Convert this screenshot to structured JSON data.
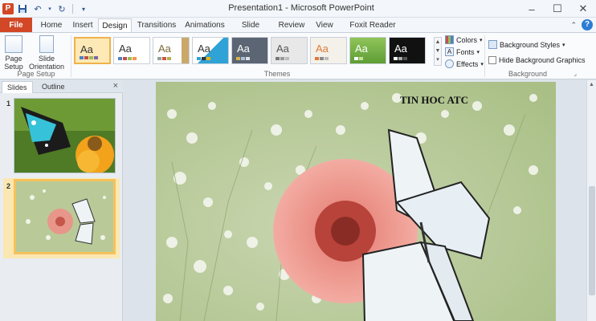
{
  "window": {
    "title": "Presentation1 - Microsoft PowerPoint"
  },
  "app_icon": "P",
  "tabs": [
    {
      "label": "File"
    },
    {
      "label": "Home"
    },
    {
      "label": "Insert"
    },
    {
      "label": "Design"
    },
    {
      "label": "Transitions"
    },
    {
      "label": "Animations"
    },
    {
      "label": "Slide Show"
    },
    {
      "label": "Review"
    },
    {
      "label": "View"
    },
    {
      "label": "Foxit Reader PDF"
    }
  ],
  "active_tab": "Design",
  "ribbon": {
    "page_setup": {
      "page_setup_label": "Page Setup",
      "slide_orientation_label": "Slide Orientation",
      "group_label": "Page Setup"
    },
    "themes": {
      "theme_glyph": "Aa",
      "group_label": "Themes"
    },
    "colors_label": "Colors",
    "fonts_label": "Fonts",
    "effects_label": "Effects",
    "background": {
      "styles_label": "Background Styles",
      "hide_graphics_label": "Hide Background Graphics",
      "group_label": "Background"
    }
  },
  "slides_pane": {
    "tabs": [
      {
        "label": "Slides"
      },
      {
        "label": "Outline"
      }
    ],
    "close": "×",
    "slides": [
      {
        "number": "1"
      },
      {
        "number": "2"
      }
    ]
  },
  "slide": {
    "title": "TIN HOC ATC"
  },
  "colors": {
    "file_tab": "#d24726",
    "selection": "#f5c25a"
  }
}
